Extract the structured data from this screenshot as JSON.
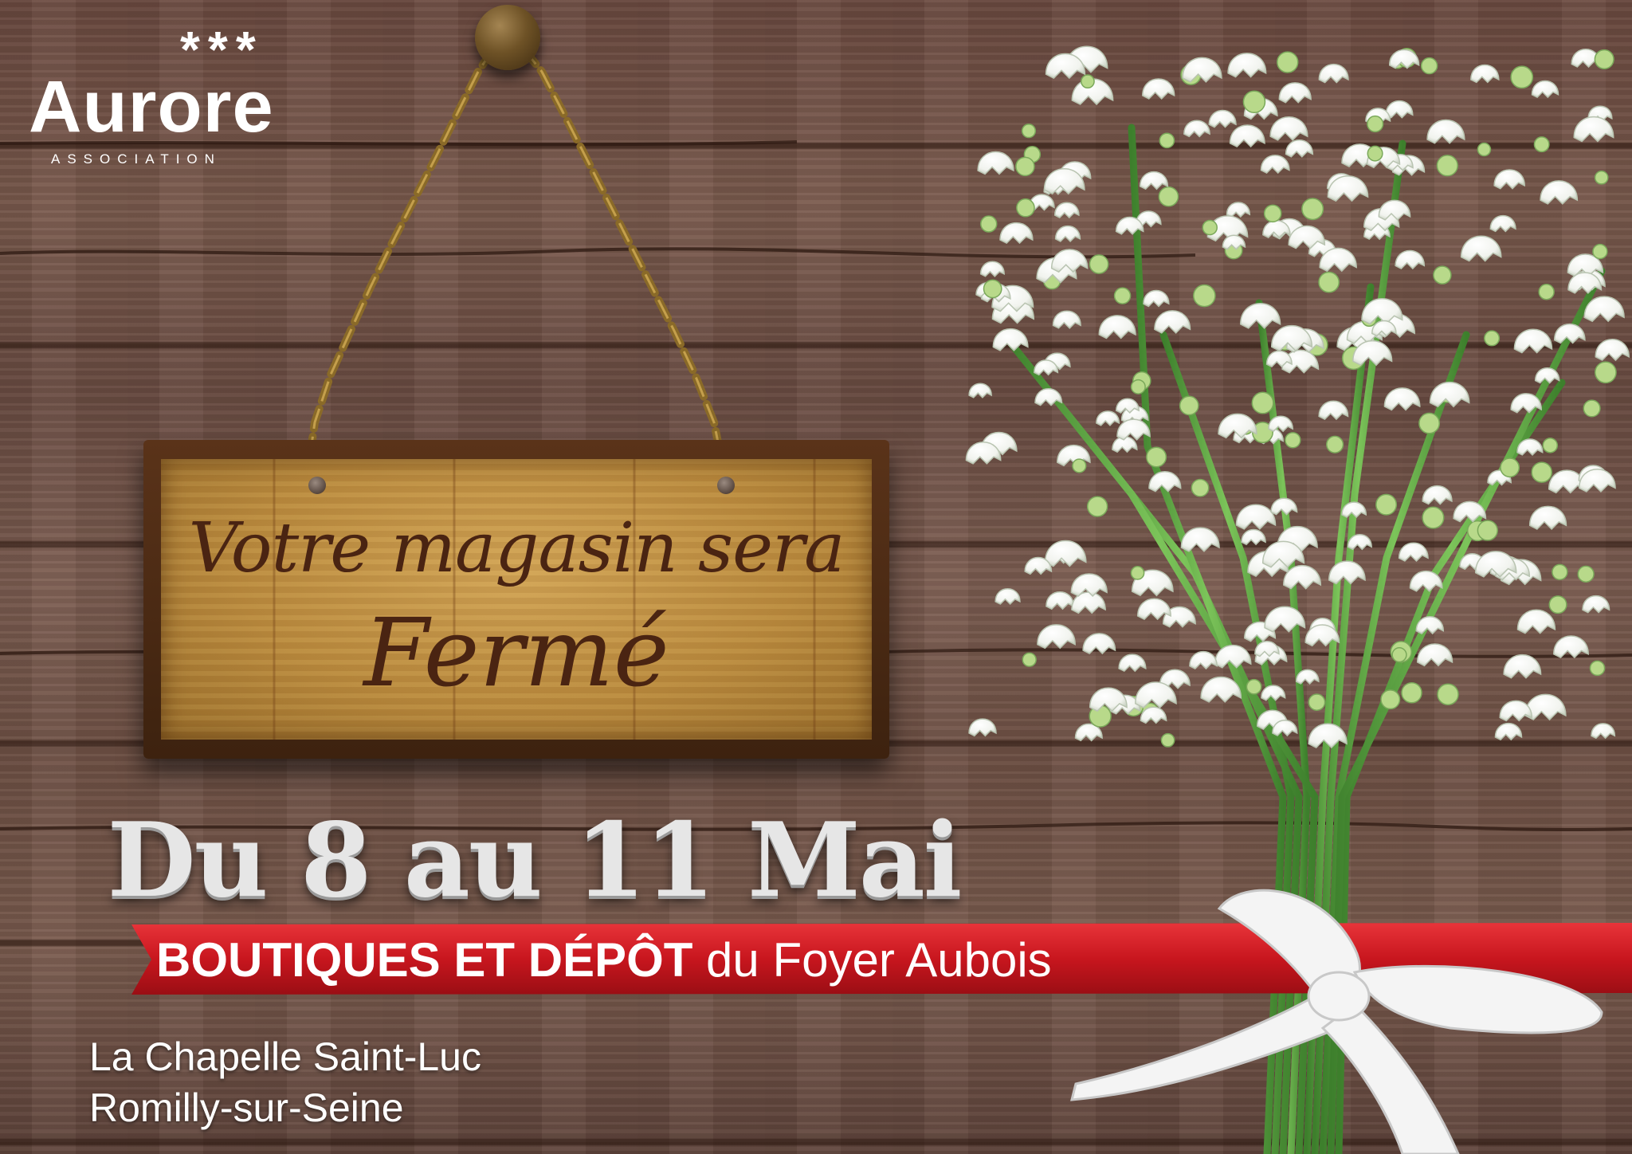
{
  "logo": {
    "stars": "***",
    "name": "Aurore",
    "subtitle": "ASSOCIATION"
  },
  "sign": {
    "line1": "Votre magasin sera",
    "line2": "Fermé"
  },
  "date_text": "Du 8 au 11 Mai",
  "ribbon": {
    "strong": "BOUTIQUES ET DÉPÔT",
    "rest": " du Foyer Aubois",
    "color": "#d11f26"
  },
  "address": {
    "line1": "La Chapelle Saint-Luc",
    "line2": "Romilly-sur-Seine"
  },
  "colors": {
    "wood_background": "#6e5044",
    "sign_frame": "#4a2a14",
    "sign_board": "#c0924a",
    "sign_text": "#4a2412",
    "chain": "#8a6a28",
    "stems": "#4f9a3a",
    "flower": "#ffffff"
  },
  "icons": {
    "nail": "nail-icon",
    "chain": "chain-icon",
    "bouquet": "lily-of-the-valley-bouquet"
  }
}
